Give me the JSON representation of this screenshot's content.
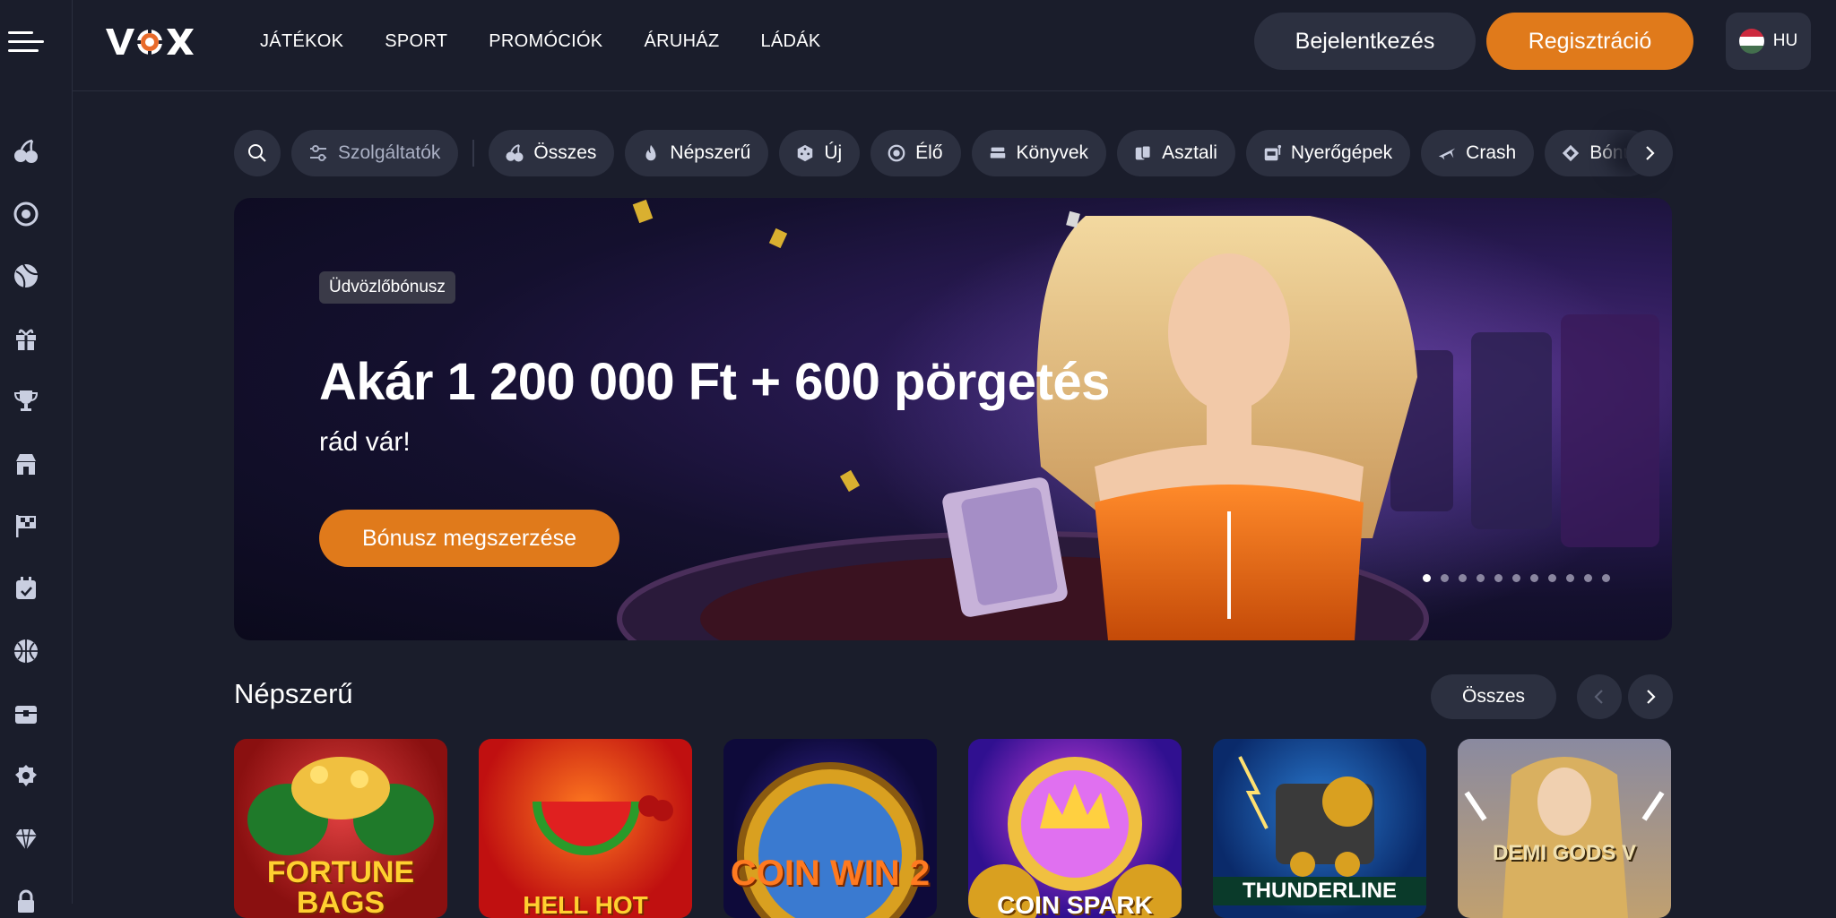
{
  "header": {
    "logo_text": "VOX",
    "nav": [
      "JÁTÉKOK",
      "SPORT",
      "PROMÓCIÓK",
      "ÁRUHÁZ",
      "LÁDÁK"
    ],
    "login_label": "Bejelentkezés",
    "register_label": "Regisztráció",
    "language": "HU"
  },
  "sidebar": {
    "icons": [
      "cherry-icon",
      "live-casino-icon",
      "sports-ball-icon",
      "gift-icon",
      "trophy-icon",
      "store-icon",
      "race-flag-icon",
      "calendar-icon",
      "basketball-icon",
      "chest-icon",
      "badge-icon",
      "diamond-icon",
      "lock-icon"
    ]
  },
  "filters": {
    "providers_label": "Szolgáltatók",
    "categories": [
      {
        "label": "Összes",
        "icon": "cherry-icon"
      },
      {
        "label": "Népszerű",
        "icon": "fire-icon"
      },
      {
        "label": "Új",
        "icon": "dice-icon"
      },
      {
        "label": "Élő",
        "icon": "live-icon"
      },
      {
        "label": "Könyvek",
        "icon": "books-icon"
      },
      {
        "label": "Asztali",
        "icon": "cards-icon"
      },
      {
        "label": "Nyerőgépek",
        "icon": "slot-machine-icon"
      },
      {
        "label": "Crash",
        "icon": "plane-icon"
      },
      {
        "label": "Bónu",
        "icon": "bonus-icon"
      }
    ]
  },
  "banner": {
    "badge": "Üdvözlőbónusz",
    "headline": "Akár 1 200 000 Ft + 600 pörgetés",
    "subline": "rád vár!",
    "cta_label": "Bónusz megszerzése",
    "slide_count": 11,
    "active_slide": 1
  },
  "popular": {
    "title": "Népszerű",
    "all_label": "Összes",
    "games": [
      {
        "title": "FORTUNE BAGS"
      },
      {
        "title": "HELL HOT"
      },
      {
        "title": "COIN WIN 2"
      },
      {
        "title": "COIN SPARK"
      },
      {
        "title": "THUNDERLINE"
      },
      {
        "title": "DEMI GODS V"
      }
    ]
  },
  "colors": {
    "background": "#1a1d2b",
    "surface": "#2c3040",
    "accent": "#e07a1b"
  }
}
